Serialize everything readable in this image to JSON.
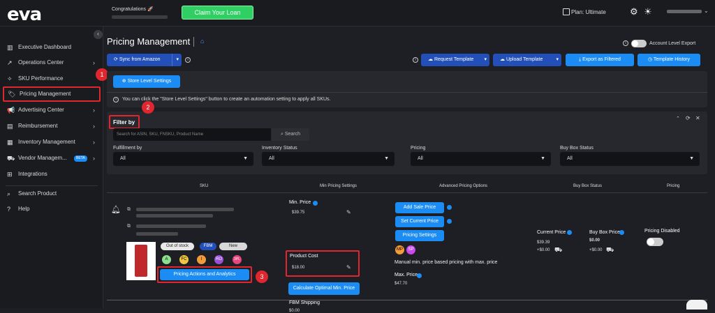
{
  "topbar": {
    "logo": "eva",
    "congrats": "Congratulations 🚀",
    "claim_label": "Claim Your Loan",
    "plan": "Plan: Ultimate"
  },
  "sidebar": {
    "items": [
      {
        "label": "Executive Dashboard"
      },
      {
        "label": "Operations Center"
      },
      {
        "label": "SKU Performance"
      },
      {
        "label": "Pricing Management"
      },
      {
        "label": "Advertising Center"
      },
      {
        "label": "Reimbursement"
      },
      {
        "label": "Inventory Management"
      },
      {
        "label": "Vendor Managem...",
        "badge": "BETA"
      },
      {
        "label": "Integrations"
      },
      {
        "label": "Search Product"
      },
      {
        "label": "Help"
      }
    ]
  },
  "main": {
    "title": "Pricing Management",
    "account_export": "Account Level Export",
    "sync_label": "Sync from Amazon",
    "request_template": "Request Template",
    "upload_template": "Upload Template",
    "export_filtered": "Export as Filtered",
    "template_history": "Template History",
    "store_level": "Store Level Settings",
    "store_info": "You can click the \"Store Level Settings\" button to create an automation setting to apply all SKUs.",
    "filter_title": "Filter by",
    "search_placeholder": "Search for ASIN, SKU, FNSKU, Product Name",
    "search_button": "Search",
    "filters": [
      {
        "label": "Fulfillment by",
        "value": "All"
      },
      {
        "label": "Inventory Status",
        "value": "All"
      },
      {
        "label": "Pricing",
        "value": "All"
      },
      {
        "label": "Buy Box Status",
        "value": "All"
      }
    ],
    "columns": [
      "SKU",
      "Min Pricing Settings",
      "Advanced Pricing Options",
      "Buy Box Status",
      "Pricing"
    ],
    "row": {
      "stock_status": "Out of stock",
      "fbm": "FBM",
      "new": "New",
      "circles": [
        "A",
        "FC",
        "I",
        "RO",
        "3PL"
      ],
      "pricing_actions": "Pricing Actions and Analytics",
      "min_price_label": "Min. Price",
      "min_price": "$39.75",
      "product_cost_label": "Product Cost",
      "product_cost": "$18.00",
      "calc_label": "Calculate Optimal Min. Price",
      "fbm_shipping_label": "FBM Shipping",
      "fbm_shipping": "$0.00",
      "add_sale": "Add Sale Price",
      "set_current": "Set Current Price",
      "pricing_settings": "Pricing Settings",
      "adv_circles": [
        "MP",
        "SP"
      ],
      "manual_note": "Manual min. price based pricing with max. price",
      "max_price_label": "Max. Price",
      "max_price": "$47.70",
      "current_price_label": "Current Price",
      "current_price": "$39.39",
      "current_ship": "+$0.00",
      "buybox_label": "Buy Box Price",
      "buybox_price": "$0.00",
      "buybox_ship": "+$0.00",
      "pricing_disabled": "Pricing Disabled"
    }
  },
  "badges": [
    "1",
    "2",
    "3"
  ]
}
